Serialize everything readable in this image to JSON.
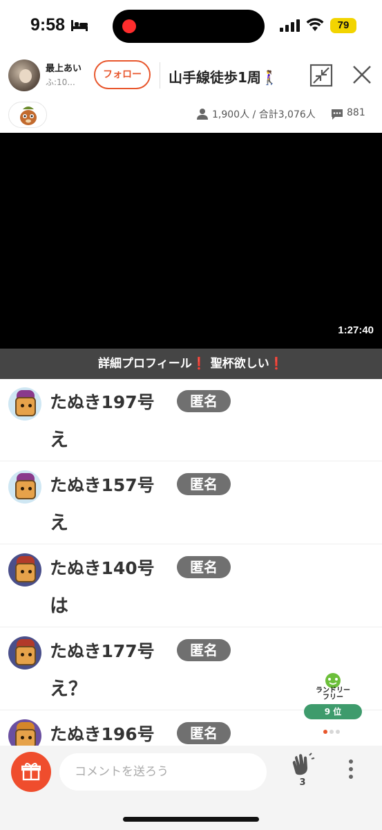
{
  "status_bar": {
    "time": "9:58",
    "battery": "79"
  },
  "header": {
    "streamer_name": "最上あい",
    "streamer_sub": "ふ:10...",
    "follow_label": "フォロー",
    "stream_title": "山手線徒歩1周🚶‍♀️"
  },
  "stats": {
    "viewers": "1,900人 / 合計3,076人",
    "comments": "881"
  },
  "video": {
    "duration": "1:27:40"
  },
  "banner": {
    "part1": "詳細プロフィール",
    "bang1": "❗",
    "part2": "聖杯欲しい",
    "bang2": "❗"
  },
  "comments": [
    {
      "name": "たぬき197号",
      "badge": "匿名",
      "text": "え",
      "hat_color": "#8a3a8c"
    },
    {
      "name": "たぬき157号",
      "badge": "匿名",
      "text": "え",
      "hat_color": "#8a3a8c"
    },
    {
      "name": "たぬき140号",
      "badge": "匿名",
      "text": "は",
      "hat_color": "#b23a2a"
    },
    {
      "name": "たぬき177号",
      "badge": "匿名",
      "text": "え？",
      "hat_color": "#b23a2a"
    },
    {
      "name": "たぬき196号",
      "badge": "匿名",
      "text": "",
      "hat_color": "#d4862a"
    }
  ],
  "ranking": {
    "logo_text_1": "ランドリー",
    "logo_text_2": "フリー",
    "rank": "9 位"
  },
  "bottom_bar": {
    "comment_placeholder": "コメントを送ろう",
    "clap_count": "3"
  },
  "colors": {
    "accent": "#e8562c",
    "gift": "#ef4d2d",
    "badge_bg": "#707070",
    "rank_green": "#3e9b6c"
  }
}
